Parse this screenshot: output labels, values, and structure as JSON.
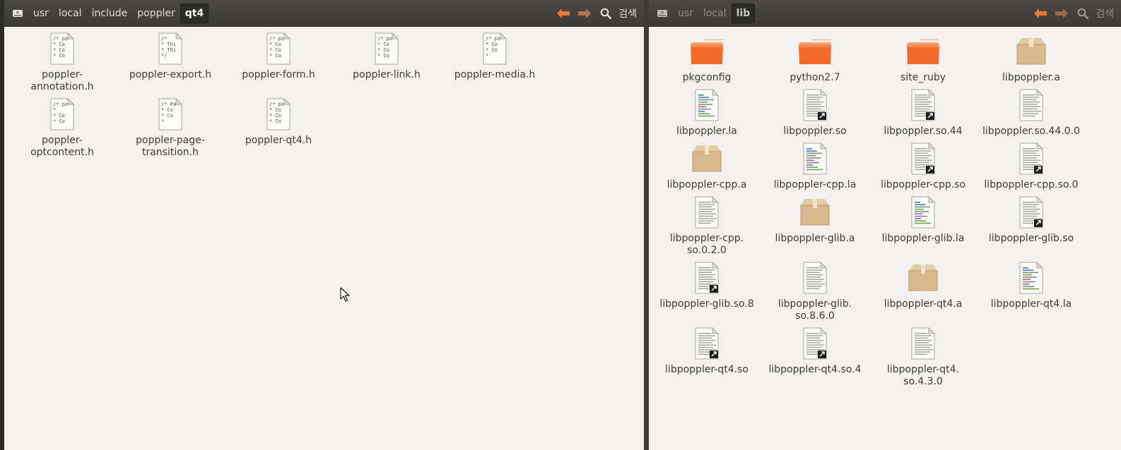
{
  "left": {
    "breadcrumbs": [
      "usr",
      "local",
      "include",
      "poppler",
      "qt4"
    ],
    "active_index": 4,
    "search_label": "검색",
    "icon_grid": [
      {
        "name": "poppler-\nannotation.h",
        "type": "header",
        "preview": [
          "/* po",
          " * Co",
          " * Co",
          " * Co"
        ]
      },
      {
        "name": "poppler-export.h",
        "type": "header",
        "preview": [
          "/*",
          "* Thi",
          "* Thi",
          "*/"
        ]
      },
      {
        "name": "poppler-form.h",
        "type": "header",
        "preview": [
          "/* po",
          " * Co",
          " * Co",
          " * Co"
        ]
      },
      {
        "name": "poppler-link.h",
        "type": "header",
        "preview": [
          "/* po",
          " * Co",
          " * Co",
          " * Co"
        ]
      },
      {
        "name": "poppler-media.h",
        "type": "header",
        "preview": [
          "/* po",
          " * Co",
          " * Co",
          " *"
        ]
      },
      {
        "name": "poppler-\noptcontent.h",
        "type": "header",
        "preview": [
          "/* po",
          " *",
          " * Co",
          " * Co"
        ]
      },
      {
        "name": "poppler-page-\ntransition.h",
        "type": "header",
        "preview": [
          "/* Pa",
          " * Co",
          " * Co",
          " *"
        ]
      },
      {
        "name": "poppler-qt4.h",
        "type": "header",
        "preview": [
          "/* po",
          " * Co",
          " * Co",
          " * Co"
        ]
      }
    ]
  },
  "right": {
    "breadcrumbs": [
      "usr",
      "local",
      "lib"
    ],
    "active_index": 2,
    "search_label": "검색",
    "icon_grid": [
      {
        "name": "pkgconfig",
        "type": "folder"
      },
      {
        "name": "python2.7",
        "type": "folder"
      },
      {
        "name": "site_ruby",
        "type": "folder"
      },
      {
        "name": "libpoppler.a",
        "type": "archive"
      },
      {
        "name": "libpoppler.la",
        "type": "libtool"
      },
      {
        "name": "libpoppler.so",
        "type": "link"
      },
      {
        "name": "libpoppler.so.44",
        "type": "link"
      },
      {
        "name": "libpoppler.so.44.0.0",
        "type": "text"
      },
      {
        "name": "libpoppler-cpp.a",
        "type": "archive"
      },
      {
        "name": "libpoppler-cpp.la",
        "type": "libtool"
      },
      {
        "name": "libpoppler-cpp.so",
        "type": "link"
      },
      {
        "name": "libpoppler-cpp.so.0",
        "type": "link"
      },
      {
        "name": "libpoppler-cpp.\nso.0.2.0",
        "type": "text"
      },
      {
        "name": "libpoppler-glib.a",
        "type": "archive"
      },
      {
        "name": "libpoppler-glib.la",
        "type": "libtool"
      },
      {
        "name": "libpoppler-glib.so",
        "type": "link"
      },
      {
        "name": "libpoppler-glib.so.8",
        "type": "link"
      },
      {
        "name": "libpoppler-glib.\nso.8.6.0",
        "type": "text"
      },
      {
        "name": "libpoppler-qt4.a",
        "type": "archive"
      },
      {
        "name": "libpoppler-qt4.la",
        "type": "libtool"
      },
      {
        "name": "libpoppler-qt4.so",
        "type": "link"
      },
      {
        "name": "libpoppler-qt4.so.4",
        "type": "link"
      },
      {
        "name": "libpoppler-qt4.\nso.4.3.0",
        "type": "text"
      }
    ]
  },
  "colors": {
    "arrow_orange": "#e8773a",
    "folder_orange": "#f26b2a",
    "archive_tan": "#d8b98e"
  },
  "icons": [
    "drive-icon",
    "back-arrow-icon",
    "forward-arrow-icon",
    "search-icon"
  ]
}
